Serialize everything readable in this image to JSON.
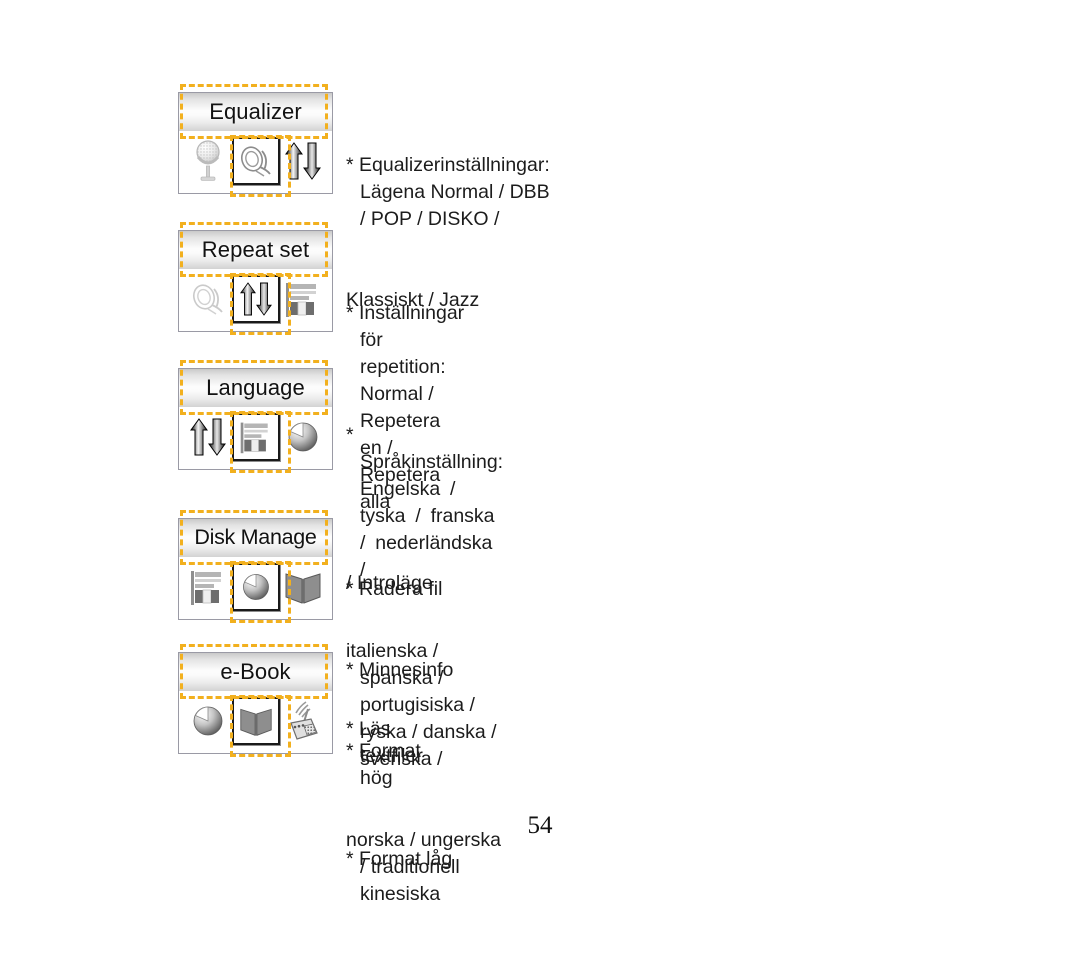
{
  "page": {
    "number": "54"
  },
  "sections": [
    {
      "id": "equalizer",
      "title": "Equalizer",
      "icons": [
        "microphone-icon",
        "speaker-icon",
        "up-down-arrows-icon"
      ],
      "highlighted_icon_index": 1,
      "lines": [
        "* Equalizerinställningar: Lägena Normal / DBB / POP / DISKO /",
        "Klassiskt / Jazz"
      ]
    },
    {
      "id": "repeat-set",
      "title": "Repeat set",
      "icons": [
        "speaker-icon",
        "up-down-arrows-icon",
        "flag-bars-icon"
      ],
      "highlighted_icon_index": 1,
      "lines": [
        "* Inställningar för repetition: Normal / Repetera en / Repetera alla",
        "/ Introläge"
      ]
    },
    {
      "id": "language",
      "title": "Language",
      "icons": [
        "up-down-arrows-icon",
        "flag-bars-icon",
        "pie-disk-icon"
      ],
      "highlighted_icon_index": 1,
      "lines": [
        "* Språkinställning: Engelska / tyska / franska / nederländska /",
        "italienska / spanska / portugisiska / ryska / danska / svenska /",
        "norska / ungerska / traditionell kinesiska"
      ]
    },
    {
      "id": "disk-manage",
      "title": "Disk Manage",
      "icons": [
        "flag-bars-icon",
        "pie-disk-icon",
        "book-icon"
      ],
      "highlighted_icon_index": 1,
      "lines": [
        "* Radera fil",
        "* Minnesinfo",
        "* Format hög",
        "* Format låg"
      ]
    },
    {
      "id": "e-book",
      "title": "e-Book",
      "icons": [
        "pie-disk-icon",
        "book-icon",
        "radio-icon"
      ],
      "highlighted_icon_index": 1,
      "lines": [
        "* Läs textfiler"
      ]
    }
  ],
  "colors": {
    "highlight": "#f2b01e",
    "panel_border": "#9a9aa5",
    "text": "#1c1c1c"
  }
}
